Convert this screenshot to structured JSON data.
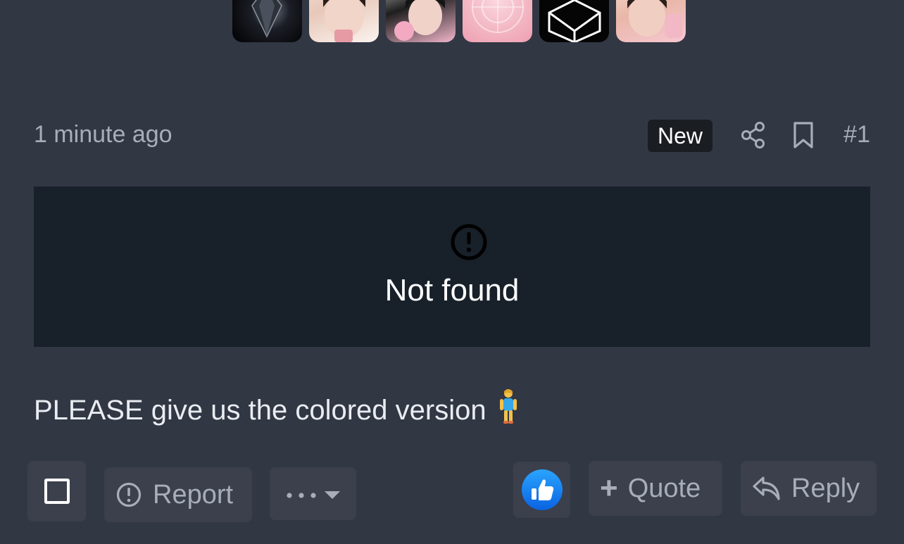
{
  "badges": [
    {
      "name": "diamond-badge"
    },
    {
      "name": "portrait-badge"
    },
    {
      "name": "portrait-badge"
    },
    {
      "name": "pink-pattern-badge"
    },
    {
      "name": "hexagon-logo-badge"
    },
    {
      "name": "portrait-badge"
    }
  ],
  "post": {
    "timestamp": "1 minute ago",
    "new_label": "New",
    "number": "#1",
    "media_error": "Not found",
    "message": "PLEASE give us the colored version",
    "emoji": "standing-person"
  },
  "actions": {
    "report_label": "Report",
    "quote_label": "Quote",
    "reply_label": "Reply"
  },
  "colors": {
    "background": "#323744",
    "button_bg": "#3b404c",
    "media_bg": "#18202a",
    "like_blue": "#1877f2"
  }
}
